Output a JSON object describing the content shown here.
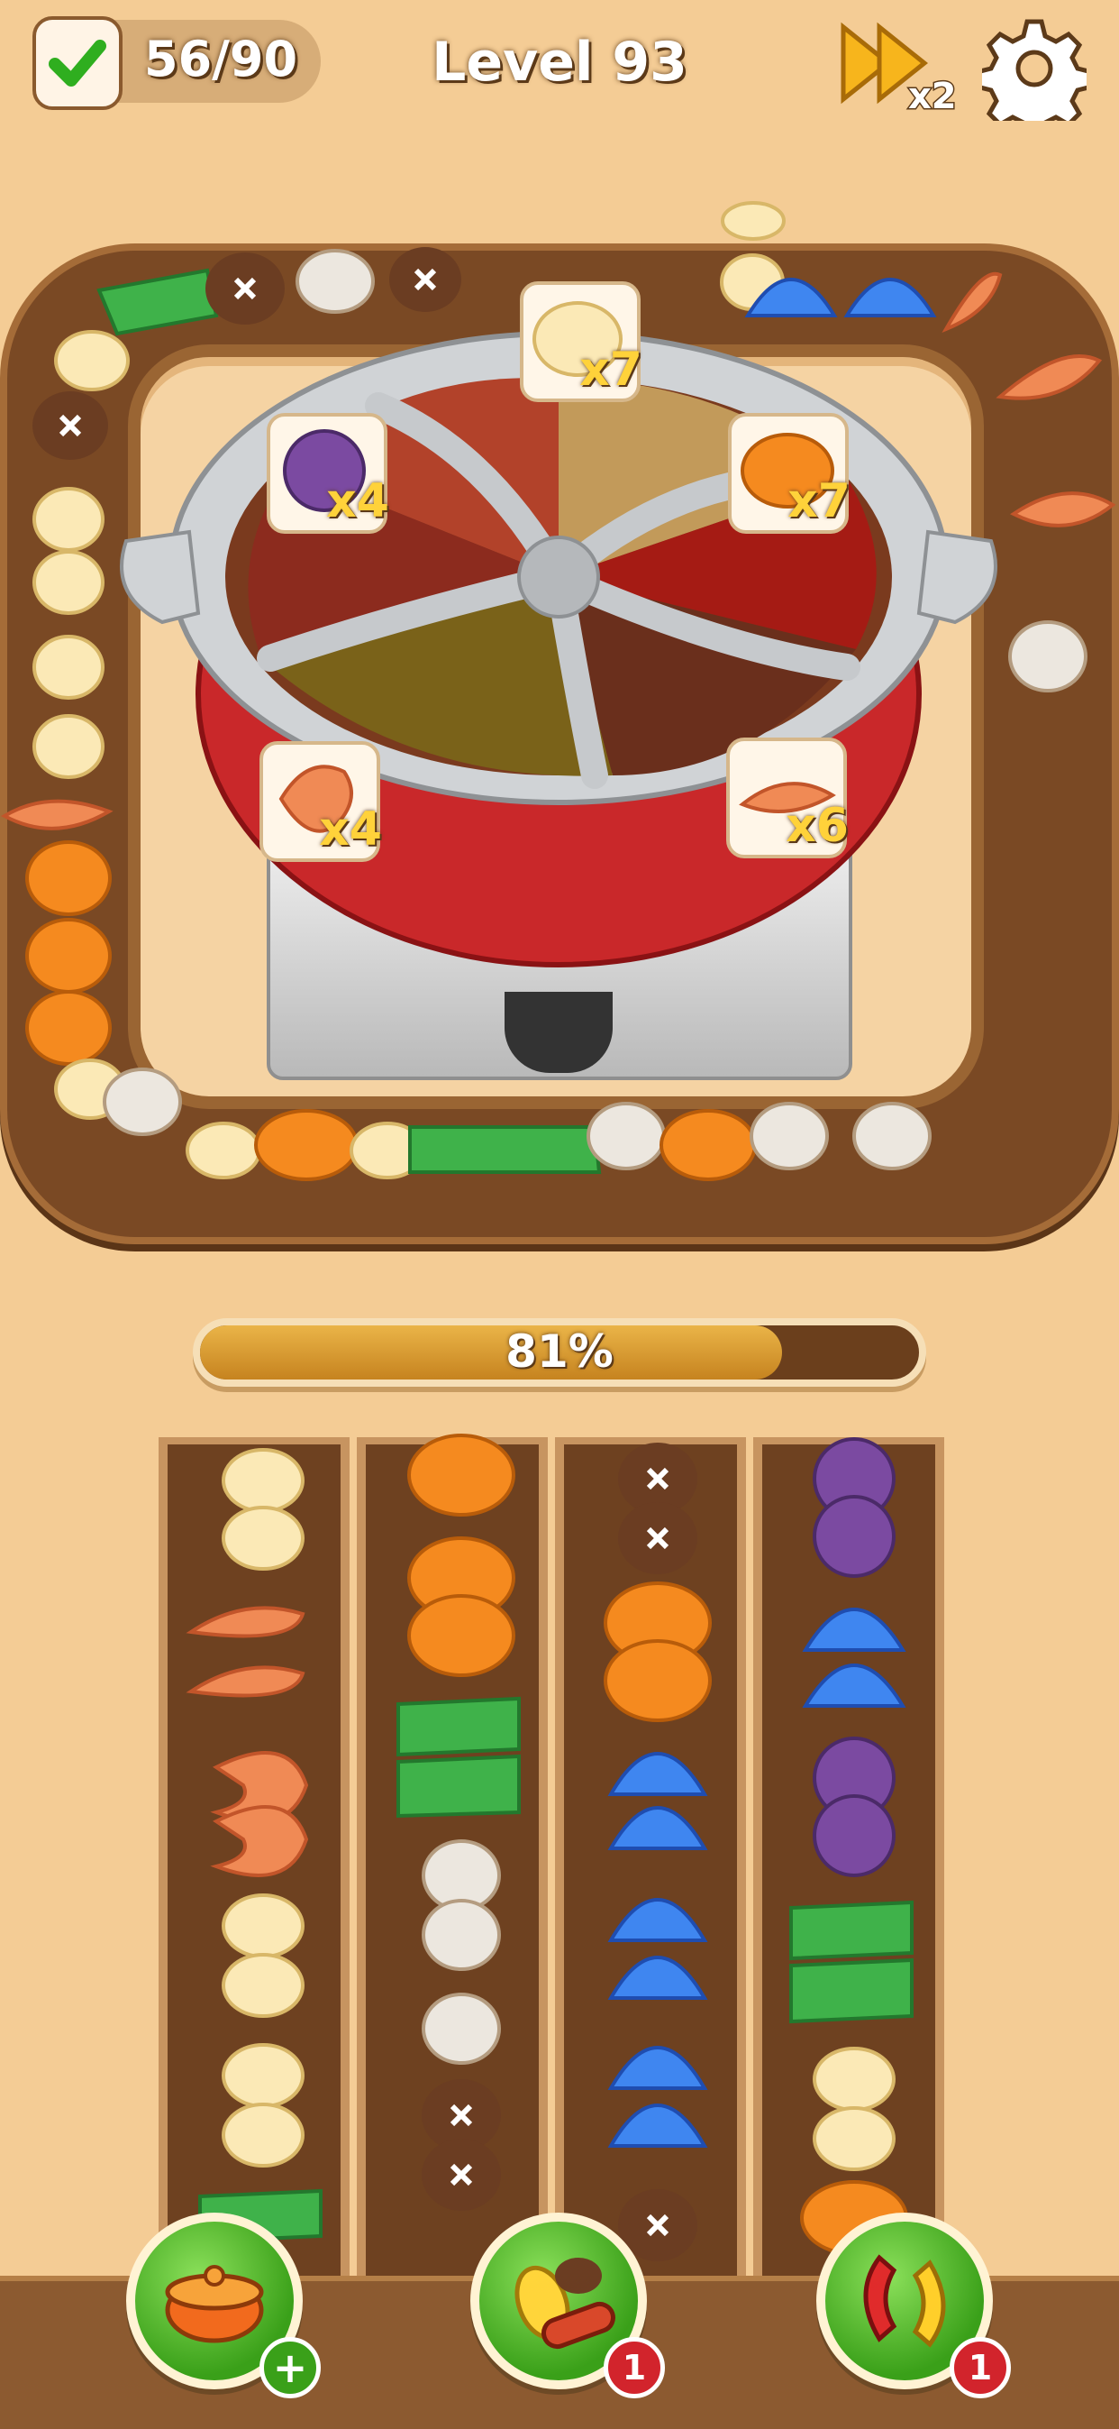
{
  "hud": {
    "completed_counter": "56/90",
    "level_label": "Level 93",
    "speed_label": "x2",
    "settings_icon": "gear-icon",
    "check_icon": "check-icon"
  },
  "pot": {
    "orders": [
      {
        "item": "banana-slice",
        "count": "x7"
      },
      {
        "item": "purple-cabbage",
        "count": "x4"
      },
      {
        "item": "pumpkin-slice",
        "count": "x7"
      },
      {
        "item": "shrimp",
        "count": "x4"
      },
      {
        "item": "prawn-tail",
        "count": "x6"
      }
    ]
  },
  "progress": {
    "percent_label": "81%",
    "value": 0.81
  },
  "boosters": [
    {
      "name": "add-pot-booster",
      "badge": "+"
    },
    {
      "name": "food-booster",
      "badge": "1"
    },
    {
      "name": "shuffle-booster",
      "badge": "1"
    }
  ],
  "colors": {
    "background": "#f4cc95",
    "tray": "#7a4924",
    "accent_green": "#3aa019",
    "badge_red": "#d2242c",
    "progress_fill": "#d99a2e"
  }
}
